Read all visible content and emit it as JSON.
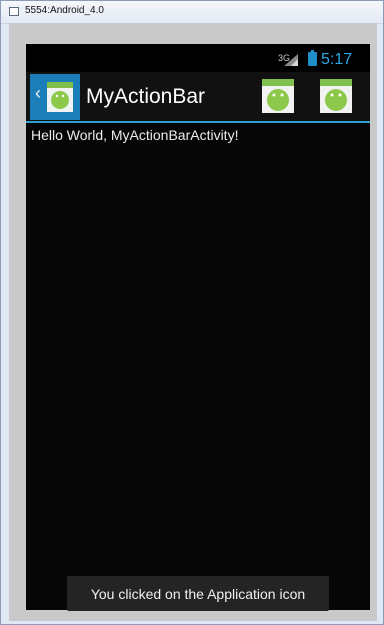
{
  "window": {
    "title": "5554:Android_4.0"
  },
  "status_bar": {
    "network": "3G",
    "time": "5:17",
    "icons": [
      "signal-icon",
      "battery-icon"
    ]
  },
  "action_bar": {
    "home_icon": "app-icon",
    "up_indicator": "‹",
    "title": "MyActionBar",
    "actions": [
      {
        "name": "action-item-1",
        "icon": "android-icon"
      },
      {
        "name": "action-item-2",
        "icon": "android-icon"
      }
    ],
    "accent_color": "#2c9fd4"
  },
  "content": {
    "hello_text": "Hello World, MyActionBarActivity!"
  },
  "toast": {
    "message": "You clicked on the Application icon"
  }
}
